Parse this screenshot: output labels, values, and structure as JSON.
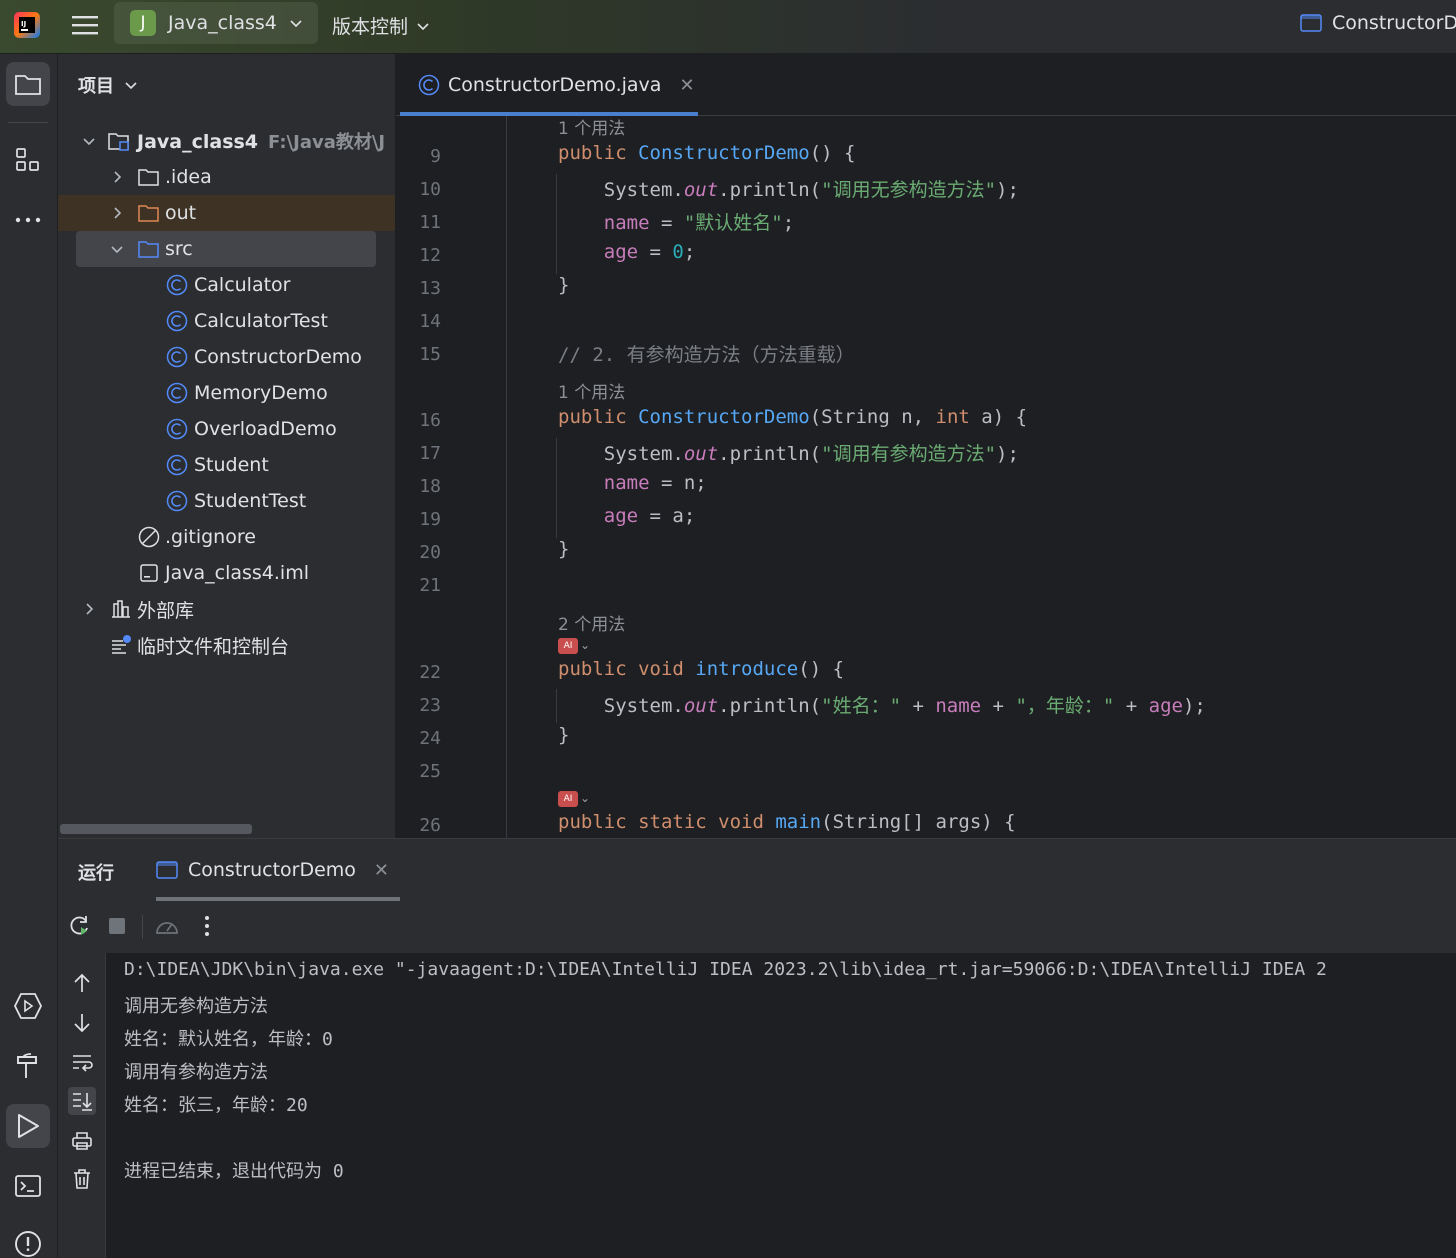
{
  "titlebar": {
    "project_badge": "J",
    "project_name": "Java_class4",
    "vcs_label": "版本控制",
    "run_config": "ConstructorD"
  },
  "project_panel": {
    "title": "项目",
    "root": {
      "name": "Java_class4",
      "path": "F:\\Java教材\\J"
    },
    "items": [
      {
        "label": ".idea",
        "kind": "folder"
      },
      {
        "label": "out",
        "kind": "folder"
      },
      {
        "label": "src",
        "kind": "source-folder"
      },
      {
        "label": "Calculator",
        "kind": "class"
      },
      {
        "label": "CalculatorTest",
        "kind": "class"
      },
      {
        "label": "ConstructorDemo",
        "kind": "class"
      },
      {
        "label": "MemoryDemo",
        "kind": "class"
      },
      {
        "label": "OverloadDemo",
        "kind": "class"
      },
      {
        "label": "Student",
        "kind": "class"
      },
      {
        "label": "StudentTest",
        "kind": "class"
      },
      {
        "label": ".gitignore",
        "kind": "ignore-file"
      },
      {
        "label": "Java_class4.iml",
        "kind": "module-file"
      },
      {
        "label": "外部库",
        "kind": "libraries"
      },
      {
        "label": "临时文件和控制台",
        "kind": "scratches"
      }
    ]
  },
  "editor": {
    "tab_label": "ConstructorDemo.java",
    "usage_hint_1": "1 个用法",
    "usage_hint_2": "2 个用法",
    "line_numbers": [
      "9",
      "10",
      "11",
      "12",
      "13",
      "14",
      "15",
      "16",
      "17",
      "18",
      "19",
      "20",
      "21",
      "22",
      "23",
      "24",
      "25",
      "26"
    ],
    "strings": {
      "s1": "\"调用无参构造方法\"",
      "s2": "\"默认姓名\"",
      "s3": "\"调用有参构造方法\"",
      "s4": "\"姓名：\"",
      "s5": "\"，年龄：\"",
      "comment": "// 2. 有参构造方法（方法重载）"
    },
    "ai_badge": "AI"
  },
  "run_window": {
    "title": "运行",
    "tab_label": "ConstructorDemo",
    "console_lines": [
      "D:\\IDEA\\JDK\\bin\\java.exe \"-javaagent:D:\\IDEA\\IntelliJ IDEA 2023.2\\lib\\idea_rt.jar=59066:D:\\IDEA\\IntelliJ IDEA 2",
      "调用无参构造方法",
      "姓名：默认姓名，年龄：0",
      "调用有参构造方法",
      "姓名：张三，年龄：20",
      "",
      "进程已结束，退出代码为 0"
    ]
  },
  "colors": {
    "background": "#1e1f22",
    "panel": "#2b2d30",
    "keyword": "#cf8e6d",
    "function": "#56a8f5",
    "string": "#6aab73",
    "field": "#c77dbb",
    "number": "#2aacb8",
    "comment": "#7a7e85",
    "accent": "#4a7fcf"
  }
}
